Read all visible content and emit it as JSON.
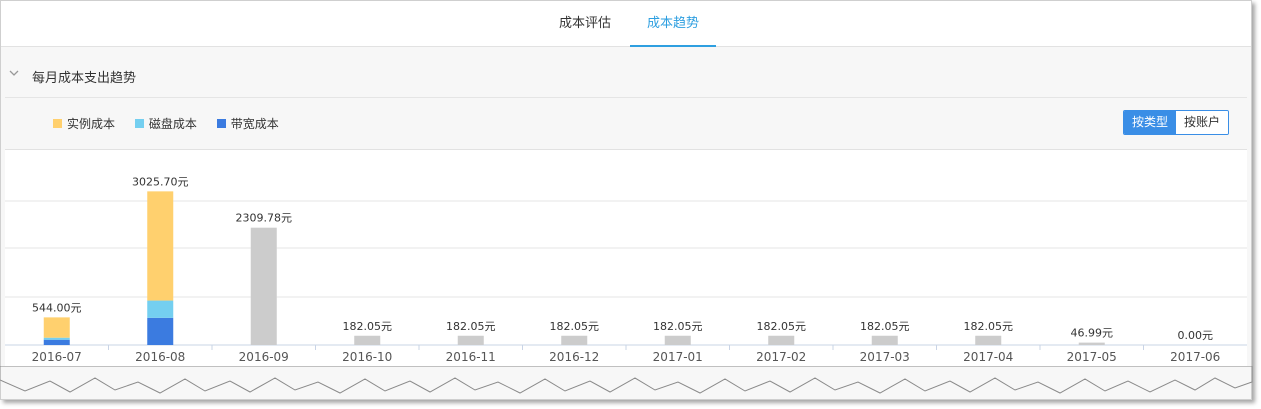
{
  "tabs": [
    {
      "label": "成本评估",
      "active": false
    },
    {
      "label": "成本趋势",
      "active": true
    }
  ],
  "section": {
    "title": "每月成本支出趋势",
    "collapse_icon": "chevron-down-icon"
  },
  "toggle": {
    "by_type": "按类型",
    "by_account": "按账户",
    "selected": "按类型"
  },
  "colors": {
    "accent": "#2e9fe0",
    "instance": "#ffd06e",
    "disk": "#74cff0",
    "bandwidth": "#3b7be0",
    "total": "#cccccc"
  },
  "chart_data": {
    "type": "bar",
    "stacked": true,
    "title": "",
    "xlabel": "",
    "ylabel": "",
    "grid": true,
    "legend": "top-left",
    "unit_suffix": "元",
    "categories": [
      "2016-07",
      "2016-08",
      "2016-09",
      "2016-10",
      "2016-11",
      "2016-12",
      "2017-01",
      "2017-02",
      "2017-03",
      "2017-04",
      "2017-05",
      "2017-06"
    ],
    "series": [
      {
        "name": "实例成本",
        "color": "#ffd06e",
        "values": [
          400,
          2150,
          null,
          null,
          null,
          null,
          null,
          null,
          null,
          null,
          null,
          null
        ]
      },
      {
        "name": "磁盘成本",
        "color": "#74cff0",
        "values": [
          40,
          340,
          null,
          null,
          null,
          null,
          null,
          null,
          null,
          null,
          null,
          null
        ]
      },
      {
        "name": "带宽成本",
        "color": "#3b7be0",
        "values": [
          104,
          535,
          null,
          null,
          null,
          null,
          null,
          null,
          null,
          null,
          null,
          null
        ]
      }
    ],
    "totals": [
      544.0,
      3025.7,
      2309.78,
      182.05,
      182.05,
      182.05,
      182.05,
      182.05,
      182.05,
      182.05,
      46.99,
      0.0
    ],
    "total_labels": [
      "544.00元",
      "3025.70元",
      "2309.78元",
      "182.05元",
      "182.05元",
      "182.05元",
      "182.05元",
      "182.05元",
      "182.05元",
      "182.05元",
      "46.99元",
      "0.00元"
    ]
  }
}
